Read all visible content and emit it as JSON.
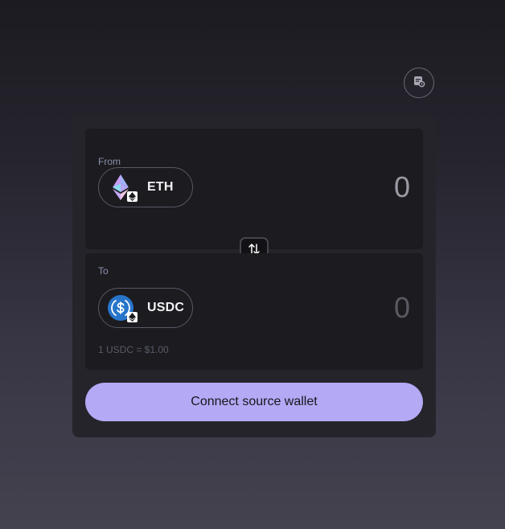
{
  "header": {
    "history_icon": "history-icon"
  },
  "from": {
    "label": "From",
    "token": {
      "symbol": "ETH",
      "icon": "ethereum-icon",
      "chain_badge_icon": "ethereum-chain-icon"
    },
    "amount": "0"
  },
  "swap": {
    "icon": "swap-arrows-icon"
  },
  "to": {
    "label": "To",
    "token": {
      "symbol": "USDC",
      "icon": "usdc-icon",
      "chain_badge_icon": "ethereum-chain-icon"
    },
    "amount": "0",
    "rate": "1 USDC = $1.00"
  },
  "actions": {
    "connect_label": "Connect source wallet"
  },
  "colors": {
    "accent": "#b3a9f5",
    "usdc_blue": "#2775ca",
    "card": "#25242b",
    "panel": "#1c1b20"
  }
}
